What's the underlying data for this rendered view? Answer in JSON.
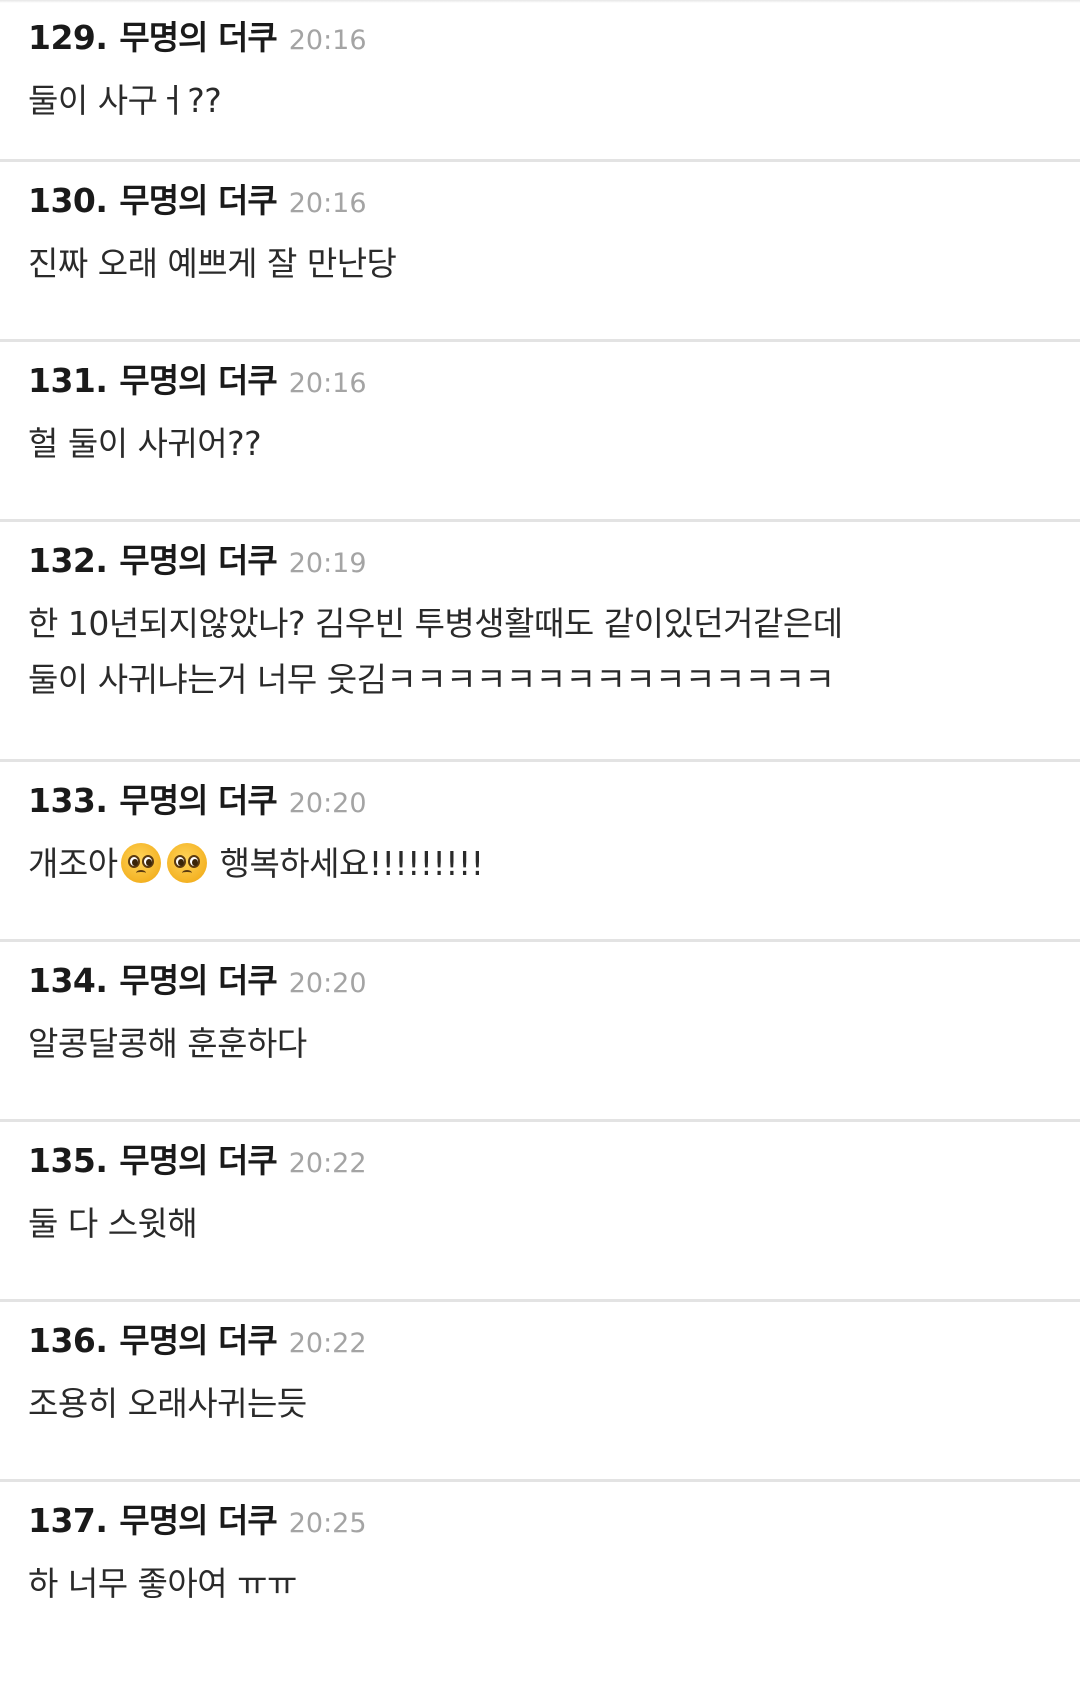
{
  "comments": [
    {
      "num": "129.",
      "author": "무명의 더쿠",
      "time": "20:16",
      "lines": [
        "둘이 사구ㅓ??"
      ]
    },
    {
      "num": "130.",
      "author": "무명의 더쿠",
      "time": "20:16",
      "lines": [
        "진짜 오래 예쁘게 잘 만난당"
      ]
    },
    {
      "num": "131.",
      "author": "무명의 더쿠",
      "time": "20:16",
      "lines": [
        "헐 둘이 사귀어??"
      ]
    },
    {
      "num": "132.",
      "author": "무명의 더쿠",
      "time": "20:19",
      "lines": [
        "한 10년되지않았나? 김우빈 투병생활때도 같이있던거같은데",
        "둘이 사귀냐는거 너무 웃김ㅋㅋㅋㅋㅋㅋㅋㅋㅋㅋㅋㅋㅋㅋㅋ"
      ]
    },
    {
      "num": "133.",
      "author": "무명의 더쿠",
      "time": "20:20",
      "text_before": "개조아",
      "text_after": " 행복하세요!!!!!!!!!",
      "emoji": "pleading-face-icon"
    },
    {
      "num": "134.",
      "author": "무명의 더쿠",
      "time": "20:20",
      "lines": [
        "알콩달콩해 훈훈하다"
      ]
    },
    {
      "num": "135.",
      "author": "무명의 더쿠",
      "time": "20:22",
      "lines": [
        "둘 다 스윗해"
      ]
    },
    {
      "num": "136.",
      "author": "무명의 더쿠",
      "time": "20:22",
      "lines": [
        "조용히 오래사귀는듯"
      ]
    },
    {
      "num": "137.",
      "author": "무명의 더쿠",
      "time": "20:25",
      "lines": [
        "하 너무 좋아여 ㅠㅠ"
      ]
    }
  ]
}
